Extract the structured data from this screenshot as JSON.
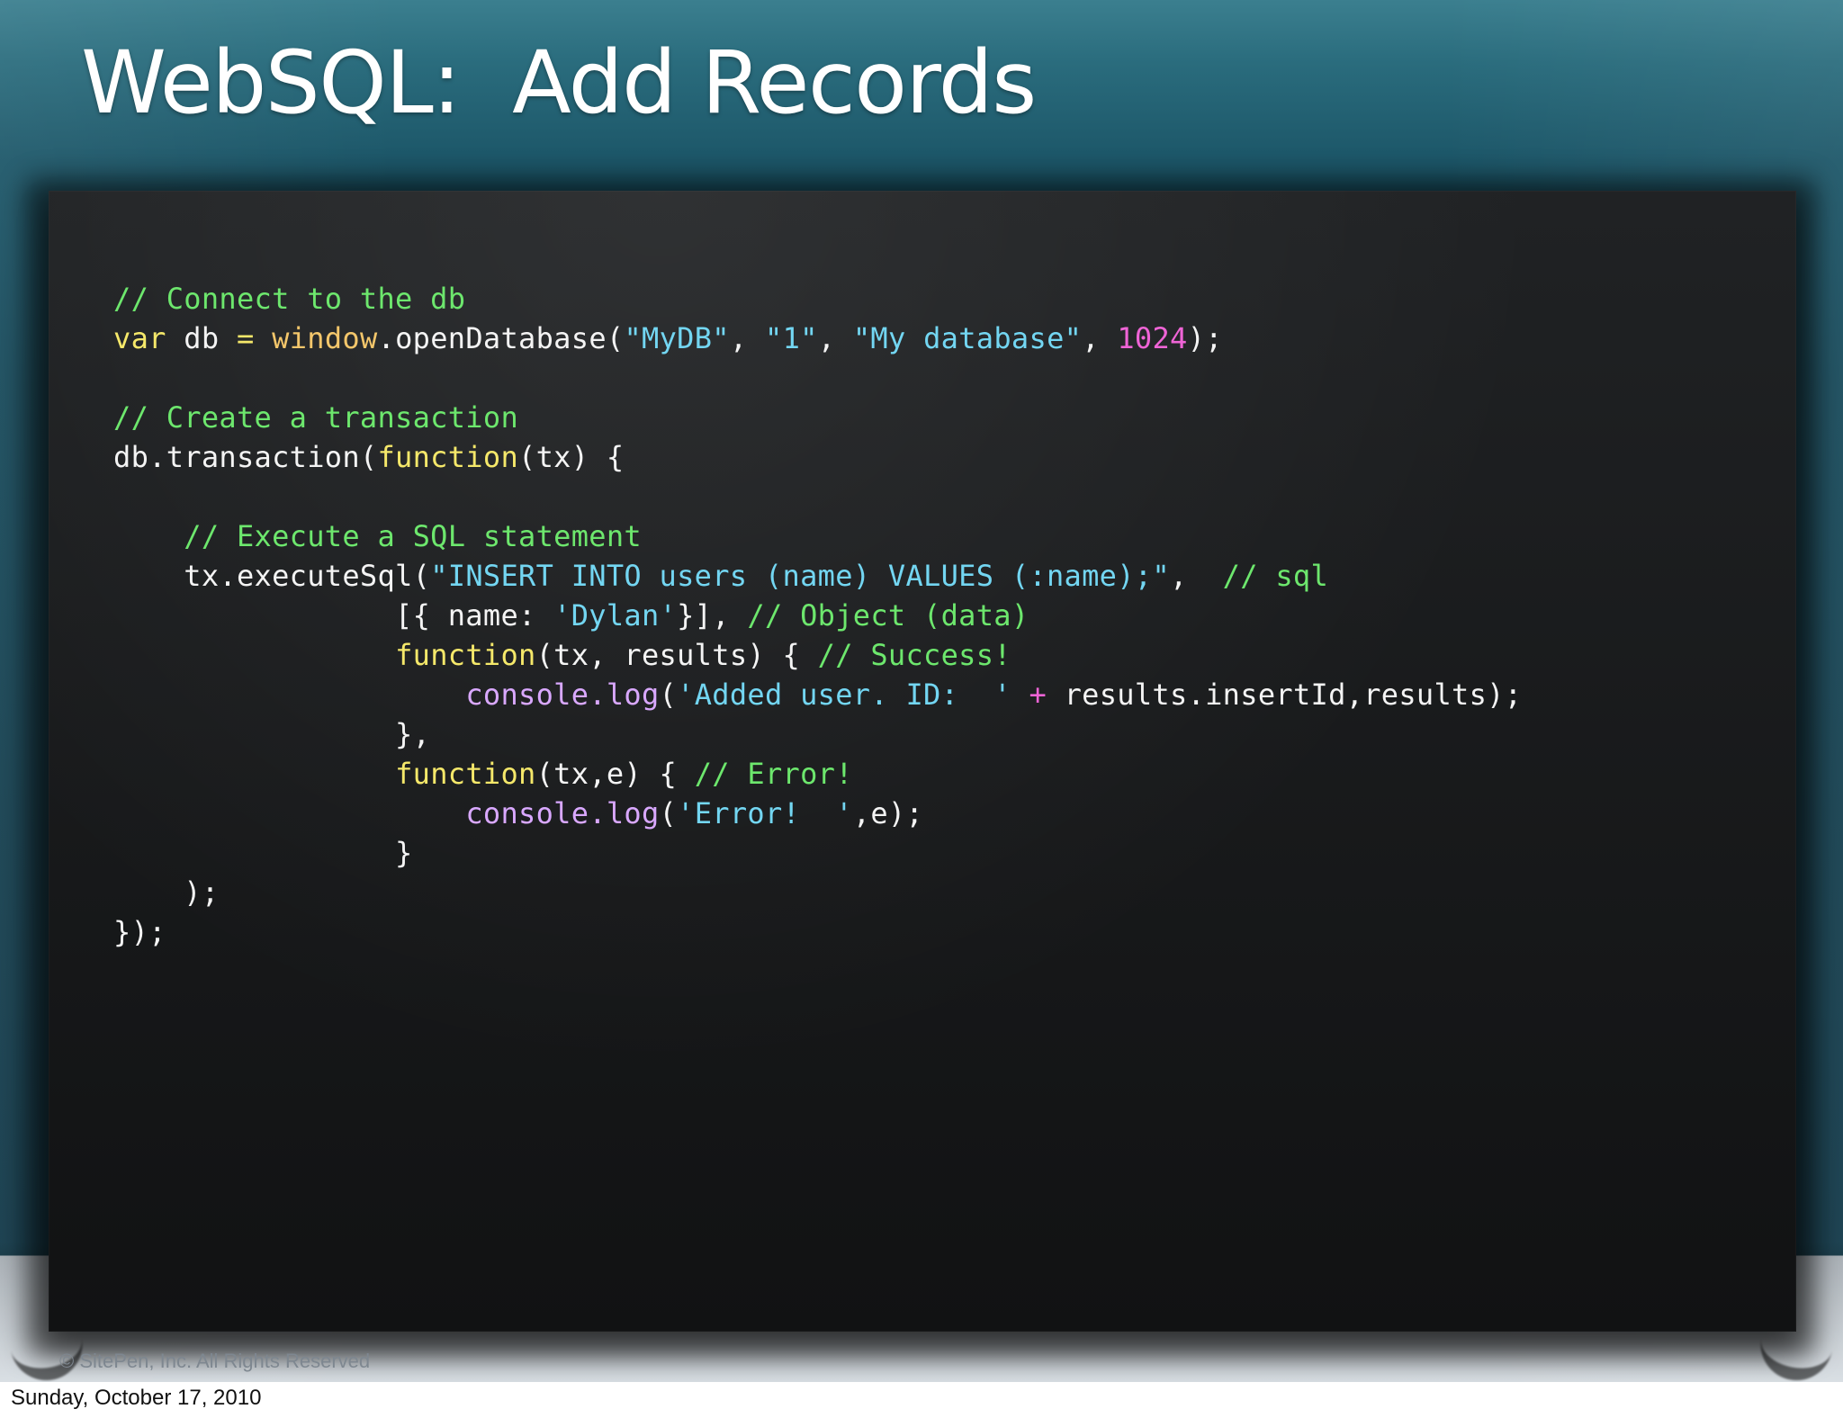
{
  "slide": {
    "title": "WebSQL:  Add Records",
    "copyright": "© SitePen, Inc. All Rights Reserved"
  },
  "code": {
    "lines": [
      [
        {
          "text": "// Connect to the db",
          "kind": "comment"
        }
      ],
      [
        {
          "text": "var",
          "kind": "keyword"
        },
        {
          "text": " db ",
          "kind": "plain"
        },
        {
          "text": "=",
          "kind": "keyword"
        },
        {
          "text": " ",
          "kind": "plain"
        },
        {
          "text": "window",
          "kind": "global"
        },
        {
          "text": ".openDatabase(",
          "kind": "plain"
        },
        {
          "text": "\"MyDB\"",
          "kind": "string"
        },
        {
          "text": ", ",
          "kind": "plain"
        },
        {
          "text": "\"1\"",
          "kind": "string"
        },
        {
          "text": ", ",
          "kind": "plain"
        },
        {
          "text": "\"My database\"",
          "kind": "string"
        },
        {
          "text": ", ",
          "kind": "plain"
        },
        {
          "text": "1024",
          "kind": "number"
        },
        {
          "text": ");",
          "kind": "plain"
        }
      ],
      [
        {
          "text": "",
          "kind": "plain"
        }
      ],
      [
        {
          "text": "// Create a transaction",
          "kind": "comment"
        }
      ],
      [
        {
          "text": "db.transaction(",
          "kind": "plain"
        },
        {
          "text": "function",
          "kind": "keyword"
        },
        {
          "text": "(tx) {",
          "kind": "plain"
        }
      ],
      [
        {
          "text": "",
          "kind": "plain"
        }
      ],
      [
        {
          "text": "    ",
          "kind": "plain"
        },
        {
          "text": "// Execute a SQL statement",
          "kind": "comment"
        }
      ],
      [
        {
          "text": "    tx.executeSql(",
          "kind": "plain"
        },
        {
          "text": "\"INSERT INTO users (name) VALUES (:name);\"",
          "kind": "string"
        },
        {
          "text": ",  ",
          "kind": "plain"
        },
        {
          "text": "// sql",
          "kind": "comment"
        }
      ],
      [
        {
          "text": "                [{ name: ",
          "kind": "plain"
        },
        {
          "text": "'Dylan'",
          "kind": "string"
        },
        {
          "text": "}], ",
          "kind": "plain"
        },
        {
          "text": "// Object (data)",
          "kind": "comment"
        }
      ],
      [
        {
          "text": "                ",
          "kind": "plain"
        },
        {
          "text": "function",
          "kind": "keyword"
        },
        {
          "text": "(tx, results) { ",
          "kind": "plain"
        },
        {
          "text": "// Success!",
          "kind": "comment"
        }
      ],
      [
        {
          "text": "                    ",
          "kind": "plain"
        },
        {
          "text": "console.log",
          "kind": "method"
        },
        {
          "text": "(",
          "kind": "plain"
        },
        {
          "text": "'Added user. ID:  '",
          "kind": "string"
        },
        {
          "text": " ",
          "kind": "plain"
        },
        {
          "text": "+",
          "kind": "number"
        },
        {
          "text": " results.insertId,results);",
          "kind": "plain"
        }
      ],
      [
        {
          "text": "                },",
          "kind": "plain"
        }
      ],
      [
        {
          "text": "                ",
          "kind": "plain"
        },
        {
          "text": "function",
          "kind": "keyword"
        },
        {
          "text": "(tx,e) { ",
          "kind": "plain"
        },
        {
          "text": "// Error!",
          "kind": "comment"
        }
      ],
      [
        {
          "text": "                    ",
          "kind": "plain"
        },
        {
          "text": "console.log",
          "kind": "method"
        },
        {
          "text": "(",
          "kind": "plain"
        },
        {
          "text": "'Error!  '",
          "kind": "string"
        },
        {
          "text": ",e);",
          "kind": "plain"
        }
      ],
      [
        {
          "text": "                }",
          "kind": "plain"
        }
      ],
      [
        {
          "text": "    );",
          "kind": "plain"
        }
      ],
      [
        {
          "text": "});",
          "kind": "plain"
        }
      ]
    ]
  },
  "footer": {
    "date": "Sunday, October 17, 2010"
  }
}
